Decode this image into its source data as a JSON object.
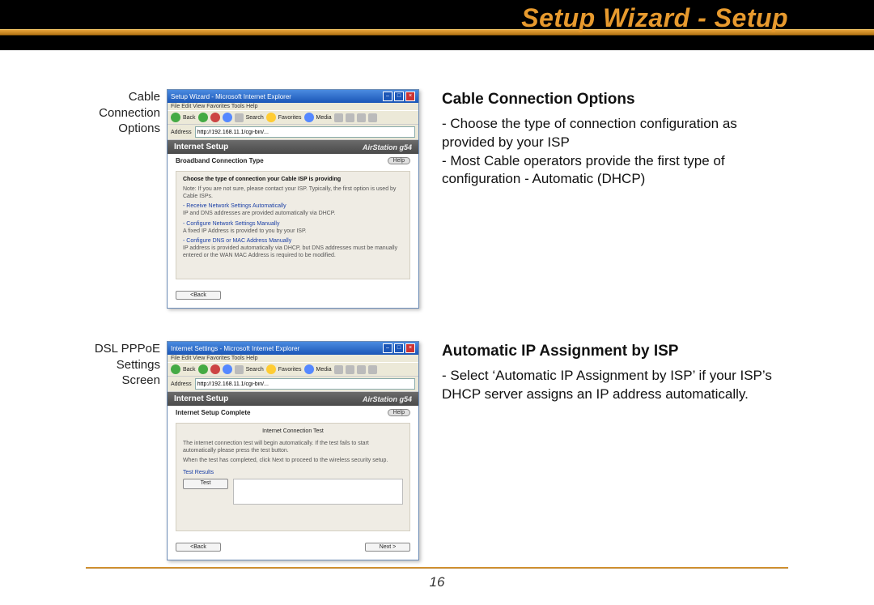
{
  "title": "Setup Wizard - Setup",
  "page_number": "16",
  "sections": [
    {
      "label_lines": [
        "Cable",
        "Connection",
        "Options"
      ],
      "heading": "Cable Connection Options",
      "bullets": [
        "- Choose the type of connection configuration as provided by your ISP",
        "- Most Cable operators provide the first type of configuration - Automatic (DHCP)"
      ],
      "screenshot": {
        "titlebar": "Setup Wizard - Microsoft Internet Explorer",
        "menubar": "File  Edit  View  Favorites  Tools  Help",
        "toolbar": {
          "back": "Back",
          "search": "Search",
          "favorites": "Favorites",
          "media": "Media"
        },
        "address_label": "Address",
        "address_value": "http://192.168.11.1/cgi-bin/...",
        "header_left": "Internet Setup",
        "header_right": "AirStation g54",
        "sub_left": "Broadband Connection Type",
        "help": "Help",
        "panel": {
          "bold1": "Choose the type of connection your Cable ISP is providing",
          "note1": "Note: If you are not sure, please contact your ISP. Typically, the first option is used by Cable ISPs.",
          "link1": "- Receive Network Settings Automatically",
          "desc1": "IP and DNS addresses are provided automatically via DHCP.",
          "link2": "- Configure Network Settings Manually",
          "desc2": "A fixed IP Address is provided to you by your ISP.",
          "link3": "- Configure DNS or MAC Address Manually",
          "desc3": "IP address is provided automatically via DHCP, but DNS addresses must be manually entered or the WAN MAC Address is required to be modified."
        },
        "back_btn": "<Back"
      }
    },
    {
      "label_lines": [
        "DSL PPPoE",
        "Settings",
        "Screen"
      ],
      "heading": "Automatic IP Assignment by ISP",
      "bullets": [
        "- Select ‘Automatic IP Assignment by ISP’ if your ISP’s DHCP server assigns an IP address automatically."
      ],
      "screenshot": {
        "titlebar": "Internet Settings - Microsoft Internet Explorer",
        "menubar": "File  Edit  View  Favorites  Tools  Help",
        "toolbar": {
          "back": "Back",
          "search": "Search",
          "favorites": "Favorites",
          "media": "Media"
        },
        "address_label": "Address",
        "address_value": "http://192.168.11.1/cgi-bin/...",
        "header_left": "Internet Setup",
        "header_right": "AirStation g54",
        "sub_left": "Internet Setup Complete",
        "help": "Help",
        "panel": {
          "testhdr": "Internet Connection Test",
          "line1": "The internet connection test will begin automatically. If the test fails to start automatically please press the test button.",
          "line2": "When the test has completed, click Next to proceed to the wireless security setup.",
          "results_label": "Test Results",
          "test_btn": "Test"
        },
        "back_btn": "<Back",
        "next_btn": "Next >"
      }
    }
  ]
}
